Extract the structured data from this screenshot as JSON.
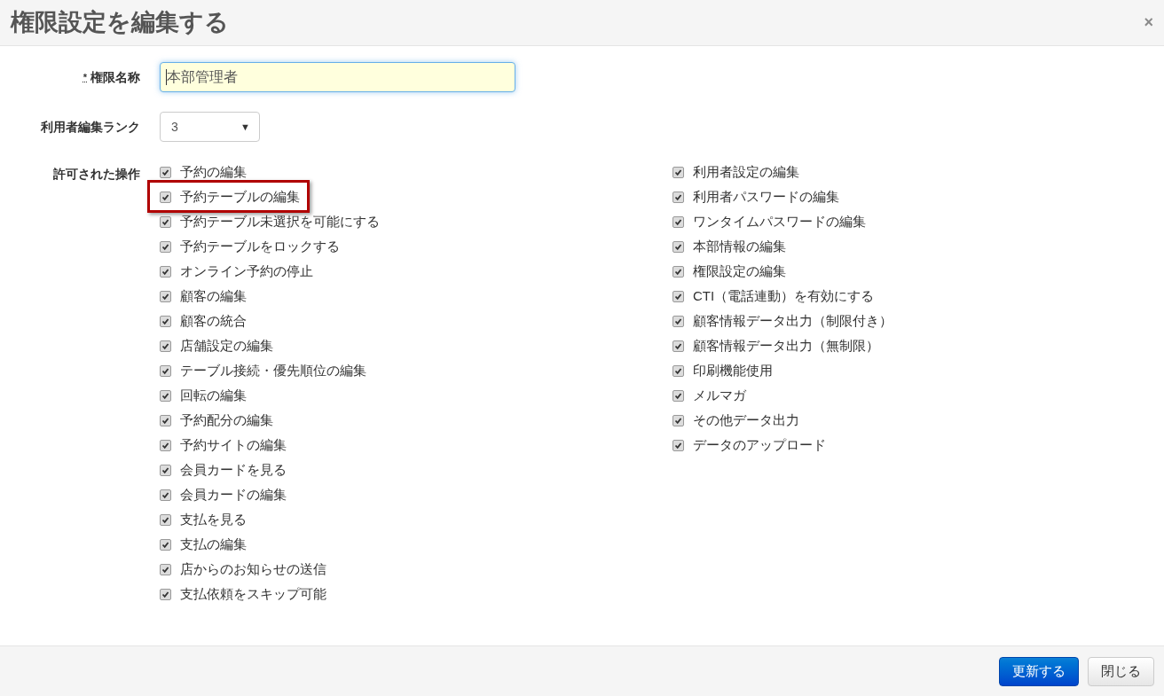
{
  "dialog": {
    "title": "権限設定を編集する",
    "close": "×"
  },
  "fields": {
    "name": {
      "required_mark": "*",
      "label": "権限名称",
      "value": "本部管理者"
    },
    "rank": {
      "label": "利用者編集ランク",
      "value": "3",
      "caret": "▼"
    },
    "permissions": {
      "label": "許可された操作",
      "columns": [
        [
          {
            "label": "予約の編集",
            "checked": true,
            "highlighted": false
          },
          {
            "label": "予約テーブルの編集",
            "checked": true,
            "highlighted": true
          },
          {
            "label": "予約テーブル未選択を可能にする",
            "checked": true,
            "highlighted": false
          },
          {
            "label": "予約テーブルをロックする",
            "checked": true,
            "highlighted": false
          },
          {
            "label": "オンライン予約の停止",
            "checked": true,
            "highlighted": false
          },
          {
            "label": "顧客の編集",
            "checked": true,
            "highlighted": false
          },
          {
            "label": "顧客の統合",
            "checked": true,
            "highlighted": false
          },
          {
            "label": "店舗設定の編集",
            "checked": true,
            "highlighted": false
          },
          {
            "label": "テーブル接続・優先順位の編集",
            "checked": true,
            "highlighted": false
          },
          {
            "label": "回転の編集",
            "checked": true,
            "highlighted": false
          },
          {
            "label": "予約配分の編集",
            "checked": true,
            "highlighted": false
          },
          {
            "label": "予約サイトの編集",
            "checked": true,
            "highlighted": false
          },
          {
            "label": "会員カードを見る",
            "checked": true,
            "highlighted": false
          },
          {
            "label": "会員カードの編集",
            "checked": true,
            "highlighted": false
          },
          {
            "label": "支払を見る",
            "checked": true,
            "highlighted": false
          },
          {
            "label": "支払の編集",
            "checked": true,
            "highlighted": false
          },
          {
            "label": "店からのお知らせの送信",
            "checked": true,
            "highlighted": false
          },
          {
            "label": "支払依頼をスキップ可能",
            "checked": true,
            "highlighted": false
          }
        ],
        [
          {
            "label": "利用者設定の編集",
            "checked": true,
            "highlighted": false
          },
          {
            "label": "利用者パスワードの編集",
            "checked": true,
            "highlighted": false
          },
          {
            "label": "ワンタイムパスワードの編集",
            "checked": true,
            "highlighted": false
          },
          {
            "label": "本部情報の編集",
            "checked": true,
            "highlighted": false
          },
          {
            "label": "権限設定の編集",
            "checked": true,
            "highlighted": false
          },
          {
            "label": "CTI（電話連動）を有効にする",
            "checked": true,
            "highlighted": false
          },
          {
            "label": "顧客情報データ出力（制限付き）",
            "checked": true,
            "highlighted": false
          },
          {
            "label": "顧客情報データ出力（無制限）",
            "checked": true,
            "highlighted": false
          },
          {
            "label": "印刷機能使用",
            "checked": true,
            "highlighted": false
          },
          {
            "label": "メルマガ",
            "checked": true,
            "highlighted": false
          },
          {
            "label": "その他データ出力",
            "checked": true,
            "highlighted": false
          },
          {
            "label": "データのアップロード",
            "checked": true,
            "highlighted": false
          }
        ]
      ]
    }
  },
  "footer": {
    "buttons": [
      {
        "label": "更新する",
        "kind": "primary"
      },
      {
        "label": "閉じる",
        "kind": "default"
      }
    ]
  }
}
